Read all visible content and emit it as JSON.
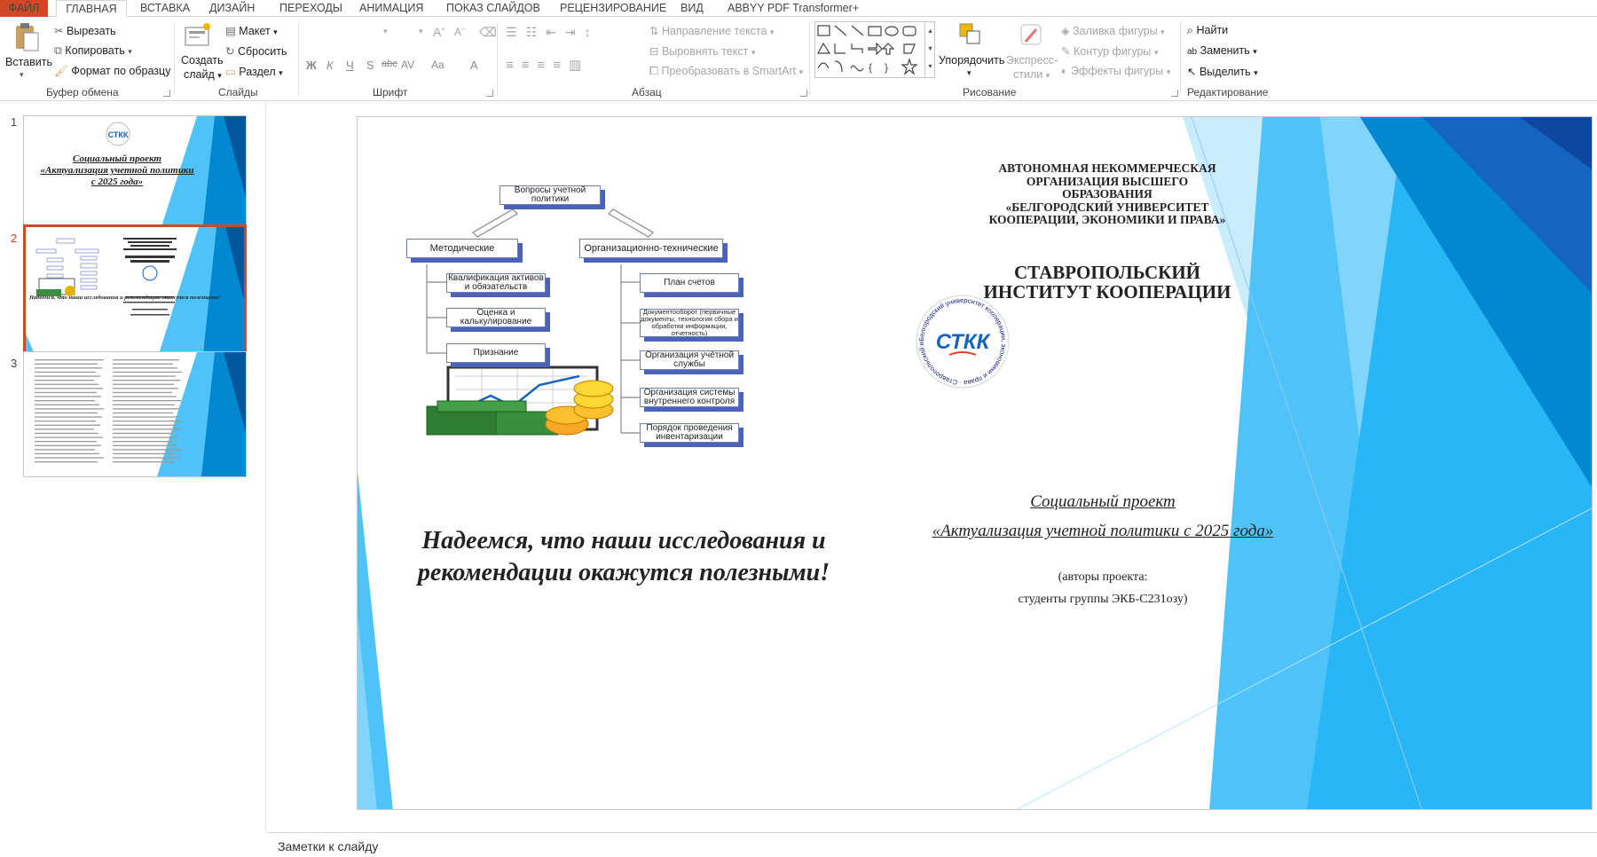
{
  "tabs": [
    "ФАЙЛ",
    "ГЛАВНАЯ",
    "ВСТАВКА",
    "ДИЗАЙН",
    "ПЕРЕХОДЫ",
    "АНИМАЦИЯ",
    "ПОКАЗ СЛАЙДОВ",
    "РЕЦЕНЗИРОВАНИЕ",
    "ВИД",
    "ABBYY PDF Transformer+"
  ],
  "ribbon": {
    "clipboard": {
      "paste": "Вставить",
      "cut": "Вырезать",
      "copy": "Копировать",
      "format_painter": "Формат по образцу",
      "group": "Буфер обмена"
    },
    "slides": {
      "new_slide_1": "Создать",
      "new_slide_2": "слайд",
      "layout": "Макет",
      "reset": "Сбросить",
      "section": "Раздел",
      "group": "Слайды"
    },
    "font": {
      "group": "Шрифт",
      "bold": "Ж",
      "italic": "К",
      "underline": "Ч",
      "shadow": "S",
      "strike": "abc",
      "spacing": "AV",
      "case": "Aa",
      "color": "A"
    },
    "paragraph": {
      "text_direction": "Направление текста",
      "align_text": "Выровнять текст",
      "smartart": "Преобразовать в SmartArt",
      "group": "Абзац"
    },
    "drawing": {
      "arrange": "Упорядочить",
      "quick_styles_1": "Экспресс-",
      "quick_styles_2": "стили",
      "shape_fill": "Заливка фигуры",
      "shape_outline": "Контур фигуры",
      "shape_effects": "Эффекты фигуры",
      "group": "Рисование"
    },
    "editing": {
      "find": "Найти",
      "replace": "Заменить",
      "select": "Выделить",
      "group": "Редактирование"
    }
  },
  "thumbnails": [
    {
      "num": "1",
      "title_1": "Социальный проект",
      "title_2": "«Актуализация учетной политики",
      "title_3": "с 2025 года»"
    },
    {
      "num": "2",
      "caption": "Надеемся, что наши исследования и рекомендации окажутся полезными!"
    },
    {
      "num": "3"
    }
  ],
  "slide": {
    "org": [
      "АВТОНОМНАЯ НЕКОММЕРЧЕСКАЯ",
      "ОРГАНИЗАЦИЯ ВЫСШЕГО",
      "ОБРАЗОВАНИЯ",
      "«БЕЛГОРОДСКИЙ УНИВЕРСИТЕТ",
      "КООПЕРАЦИИ, ЭКОНОМИКИ И ПРАВА»"
    ],
    "institute": [
      "СТАВРОПОЛЬСКИЙ",
      "ИНСТИТУТ КООПЕРАЦИИ"
    ],
    "logo_text": "СТКК",
    "logo_ring_text": "Белгородский университет кооперации, экономики и права · Ставропольский институт кооперации (филиал)",
    "project_title_1": "Социальный проект",
    "project_title_2": "«Актуализация учетной политики с 2025 года»",
    "authors_1": "(авторы проекта:",
    "authors_2": "студенты группы ЭКБ-С231озу)",
    "hope_1": "Надеемся, что наши исследования и",
    "hope_2": "рекомендации окажутся полезными!",
    "diagram": {
      "top": "Вопросы учетной политики",
      "left_head": "Методические",
      "right_head": "Организационно-технические",
      "left_items": [
        "Квалификация активов и обязательств",
        "Оценка и калькулирование",
        "Признание"
      ],
      "right_items": [
        "План счетов",
        "Документооборот (первичные документы, технология сбора и обработки информации, отчетность)",
        "Организация учётной службы",
        "Организация системы внутреннего контроля",
        "Порядок проведения инвентаризации"
      ]
    }
  },
  "notes_placeholder": "Заметки к слайду",
  "colors": {
    "accent": "#d24726",
    "diagram_blue": "#4a63b8",
    "slide_blue": "#29b6f6"
  }
}
